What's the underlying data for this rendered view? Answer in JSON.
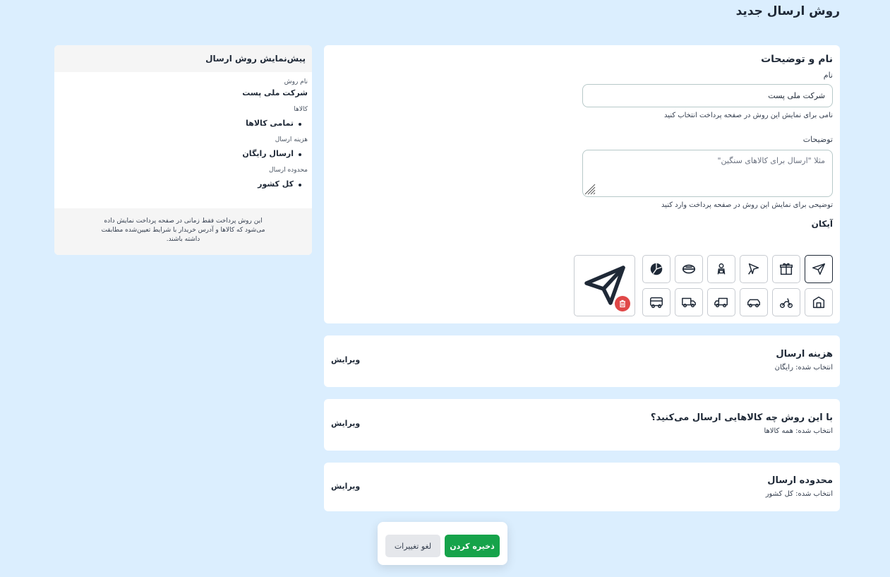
{
  "page": {
    "title": "روش ارسال جدید"
  },
  "name_section": {
    "title": "نام و توضیحات",
    "name_label": "نام",
    "name_value": "شرکت ملی پست",
    "name_hint": "نامی برای نمایش این روش در صفحه پرداخت انتخاب کنید",
    "description_label": "توضیحات",
    "description_placeholder": "مثلا \"ارسال برای کالاهای سنگین\"",
    "description_hint": "توضیحی برای نمایش این روش در صفحه پرداخت وارد کنید",
    "icons_label": "آیکان",
    "icons_row1": [
      "paper-plane-icon",
      "gift-icon",
      "rocket-icon",
      "courier-icon",
      "delivery-bag-icon",
      "pie-icon"
    ],
    "icons_row2": [
      "warehouse-icon",
      "motor-scooter-icon",
      "car-icon",
      "truck-icon",
      "van-icon",
      "bus-icon"
    ],
    "selected_icon": "paper-plane-icon"
  },
  "cost_section": {
    "title": "هزینه ارسال",
    "selected": "انتخاب شده: رایگان",
    "edit_label": "ویرایش"
  },
  "products_section": {
    "title": "با این روش چه کالاهایی ارسال می‌کنید؟",
    "selected": "انتخاب شده: همه کالاها",
    "edit_label": "ویرایش"
  },
  "area_section": {
    "title": "محدوده ارسال",
    "selected": "انتخاب شده: کل کشور",
    "edit_label": "ویرایش"
  },
  "preview": {
    "title": "پیش‌نمایش روش ارسال",
    "method_label": "نام روش",
    "method_value": "شرکت ملی پست",
    "products_label": "کالاها",
    "products_value": "تمامی کالاها",
    "cost_label": "هزینه ارسال",
    "cost_value": "ارسال رایگان",
    "area_label": "محدوده ارسال",
    "area_value": "کل کشور",
    "note": "این روش پرداخت فقط زمانی در صفحه پرداخت نمایش داده می‌شود که کالاها و آدرس خریدار با شرایط تعیین‌شده مطابقت داشته باشند."
  },
  "actions": {
    "save_label": "ذخیره کردن",
    "cancel_label": "لغو تغییرات"
  },
  "colors": {
    "background": "#dbeefe",
    "save": "#16a34a",
    "delete": "#e04848"
  }
}
